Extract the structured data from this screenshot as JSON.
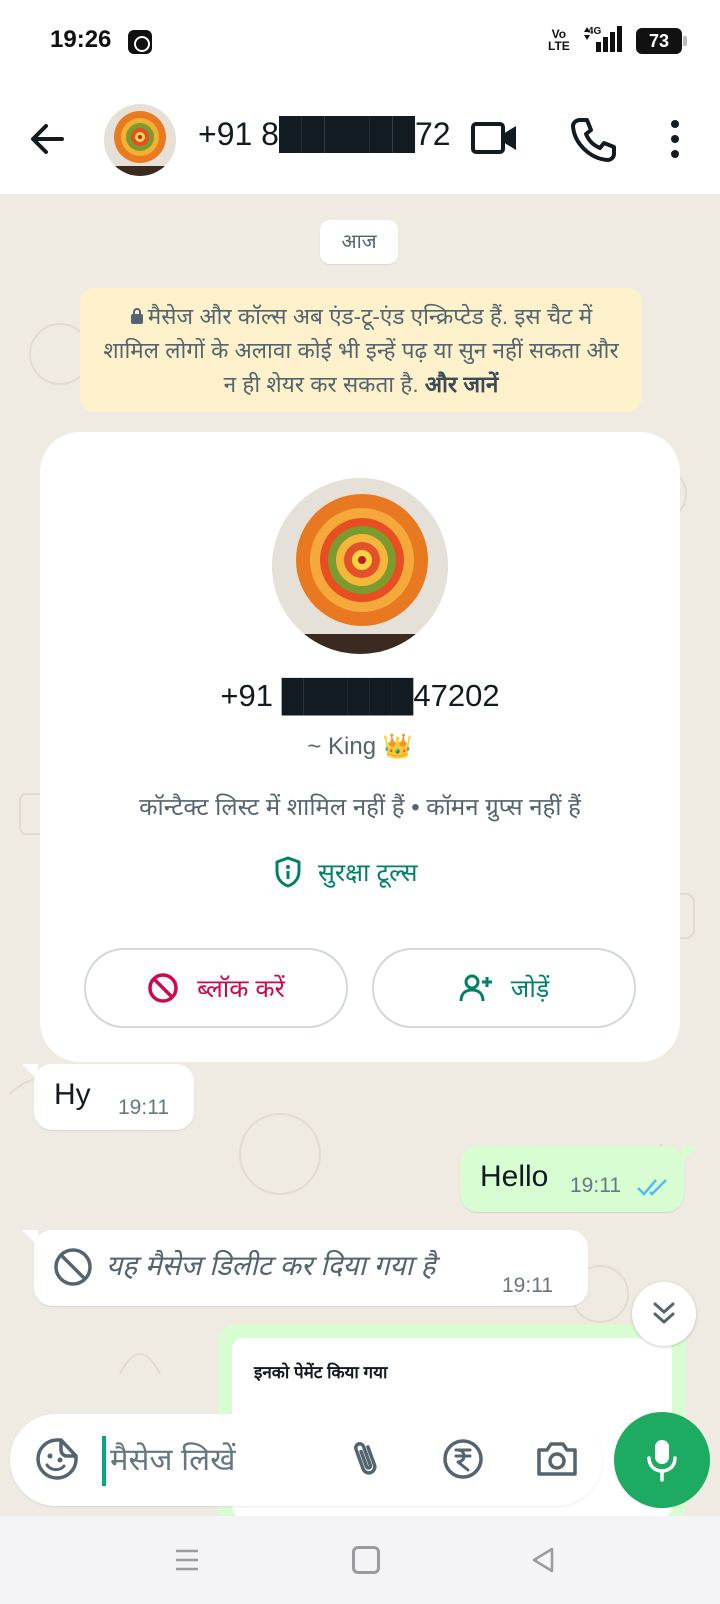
{
  "status_bar": {
    "time": "19:26",
    "volte_top": "Vo",
    "volte_bottom": "LTE",
    "network": "4G",
    "battery": "73"
  },
  "header": {
    "title": "+91 8██████72...",
    "icons": [
      "back-arrow-icon",
      "video-call-icon",
      "phone-icon",
      "more-vert-icon"
    ]
  },
  "chat": {
    "date_chip": "आज",
    "e2e_notice": {
      "text": "मैसेज और कॉल्स अब एंड-टू-एंड एन्क्रिप्टेड हैं. इस चैट में शामिल लोगों के अलावा कोई भी इन्हें पढ़ या सुन नहीं सकता और न ही शेयर कर सकता है.",
      "link": "और जानें"
    },
    "contact_card": {
      "phone": "+91 ██████47202",
      "about": "~ King 👑",
      "info": "कॉन्टैक्ट लिस्ट में शामिल नहीं हैं • कॉमन ग्रुप्स नहीं हैं",
      "safety_tools": "सुरक्षा टूल्स",
      "block_label": "ब्लॉक करें",
      "add_label": "जोड़ें"
    },
    "messages": [
      {
        "direction": "in",
        "text": "Hy",
        "time": "19:11"
      },
      {
        "direction": "out",
        "text": "Hello",
        "time": "19:11",
        "status": "read"
      },
      {
        "direction": "in",
        "text": "यह मैसेज डिलीट कर दिया गया है",
        "time": "19:11",
        "deleted": true
      }
    ],
    "payment_preview": "इनको पेमेंट किया गया"
  },
  "input": {
    "placeholder": "मैसेज लिखें",
    "value": ""
  },
  "colors": {
    "accent": "#008069",
    "mic_button": "#1daa61",
    "outgoing_bubble": "#d9fdd3",
    "block": "#d1064e",
    "read_ticks": "#53bdeb"
  }
}
